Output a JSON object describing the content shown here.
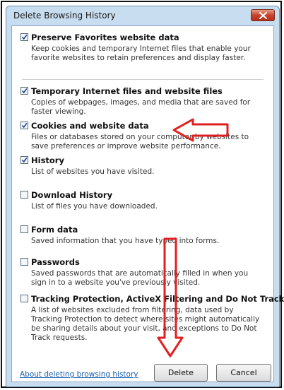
{
  "dialog": {
    "title": "Delete Browsing History"
  },
  "options": [
    {
      "label": "Preserve Favorites website data",
      "checked": true,
      "description": "Keep cookies and temporary Internet files that enable your favorite websites to retain preferences and display faster."
    },
    {
      "label": "Temporary Internet files and website files",
      "checked": true,
      "description": "Copies of webpages, images, and media that are saved for faster viewing."
    },
    {
      "label": "Cookies and website data",
      "checked": true,
      "description": "Files or databases stored on your computer by websites to save preferences or improve website performance."
    },
    {
      "label": "History",
      "checked": true,
      "description": "List of websites you have visited."
    },
    {
      "label": "Download History",
      "checked": false,
      "description": "List of files you have downloaded."
    },
    {
      "label": "Form data",
      "checked": false,
      "description": "Saved information that you have typed into forms."
    },
    {
      "label": "Passwords",
      "checked": false,
      "description": "Saved passwords that are automatically filled in when you sign in to a website you've previously visited."
    },
    {
      "label": "Tracking Protection, ActiveX Filtering and Do Not Track",
      "checked": false,
      "description": "A list of websites excluded from filtering, data used by Tracking Protection to detect where sites might automatically be sharing details about your visit, and exceptions to Do Not Track requests."
    }
  ],
  "footer": {
    "link_label": "About deleting browsing history",
    "delete_label": "Delete",
    "cancel_label": "Cancel"
  },
  "colors": {
    "annotation_arrow": "#e02020",
    "window_frame": "#c9ddf0",
    "close_button": "#c8432a"
  }
}
